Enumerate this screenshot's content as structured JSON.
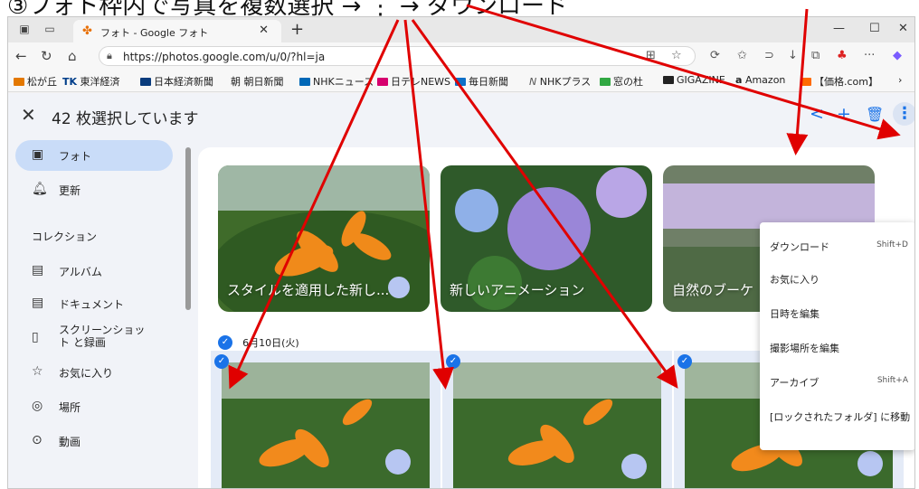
{
  "caption": "③フォト枠内で写真を複数選択 → ⋮ → ダウンロード",
  "browser": {
    "tab_title": "フォト - Google フォト",
    "url": "https://photos.google.com/u/0/?hl=ja",
    "bookmarks": [
      "松が丘",
      "東洋経済",
      "日本経済新聞",
      "朝日新聞",
      "NHKニュース",
      "日テレNEWS",
      "毎日新聞",
      "NHKプラス",
      "窓の杜",
      "GIGAZINE",
      "Amazon",
      "【価格.com】"
    ],
    "bookmark_prefix_tk": "TK",
    "bookmark_prefix_asahi": "朝",
    "bookmark_prefix_nhkplus": "N",
    "bookmark_prefix_amazon": "a"
  },
  "app": {
    "selection_text": "42 枚選択しています",
    "sidebar": {
      "items": [
        {
          "label": "フォト",
          "icon": "photo-icon"
        },
        {
          "label": "更新",
          "icon": "bell-icon"
        }
      ],
      "section_title": "コレクション",
      "collections": [
        {
          "label": "アルバム",
          "icon": "album-icon"
        },
        {
          "label": "ドキュメント",
          "icon": "document-icon"
        },
        {
          "label": "スクリーンショット と録画",
          "icon": "phone-icon"
        },
        {
          "label": "お気に入り",
          "icon": "star-icon"
        },
        {
          "label": "場所",
          "icon": "location-icon"
        },
        {
          "label": "動画",
          "icon": "play-icon"
        }
      ]
    },
    "cards": [
      "スタイルを適用した新し...",
      "新しいアニメーション",
      "自然のブーケ"
    ],
    "date_label": "6月10日(火)",
    "menu": [
      {
        "label": "ダウンロード",
        "shortcut": "Shift+D"
      },
      {
        "label": "お気に入り",
        "shortcut": ""
      },
      {
        "label": "日時を編集",
        "shortcut": ""
      },
      {
        "label": "撮影場所を編集",
        "shortcut": ""
      },
      {
        "label": "アーカイブ",
        "shortcut": "Shift+A"
      },
      {
        "label": "[ロックされたフォルダ] に移動",
        "shortcut": ""
      }
    ]
  },
  "colors": {
    "accent": "#1a73e8",
    "arrow": "#e00000",
    "active": "#c9dcf8"
  }
}
